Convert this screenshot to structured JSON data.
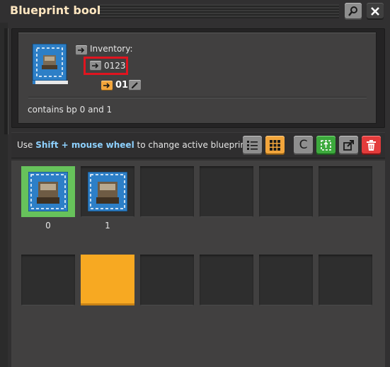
{
  "window": {
    "title": "Blueprint book"
  },
  "book": {
    "inventory_label": "Inventory:",
    "inventory_value": "0123",
    "active_slot": "01",
    "description": "contains bp 0 and 1"
  },
  "hint": {
    "prefix": "Use",
    "key": "Shift + mouse wheel",
    "suffix": "to change active blueprint."
  },
  "toolbar": {
    "clear_label": "C"
  },
  "slots": [
    {
      "label": "0",
      "filled": true,
      "selected": true
    },
    {
      "label": "1",
      "filled": true,
      "selected": false
    }
  ],
  "colors": {
    "title": "#ffe6c0",
    "accent_orange": "#f2a53b",
    "selected_green": "#67c25b",
    "highlight_red": "#e0141f",
    "hint_key": "#8ed1ff"
  },
  "icons": [
    "search-icon",
    "close-icon",
    "blueprint-book-icon",
    "arrow-icon",
    "pencil-icon",
    "list-view-icon",
    "grid-view-icon",
    "select-area-icon",
    "export-icon",
    "trash-icon",
    "blueprint-icon"
  ]
}
